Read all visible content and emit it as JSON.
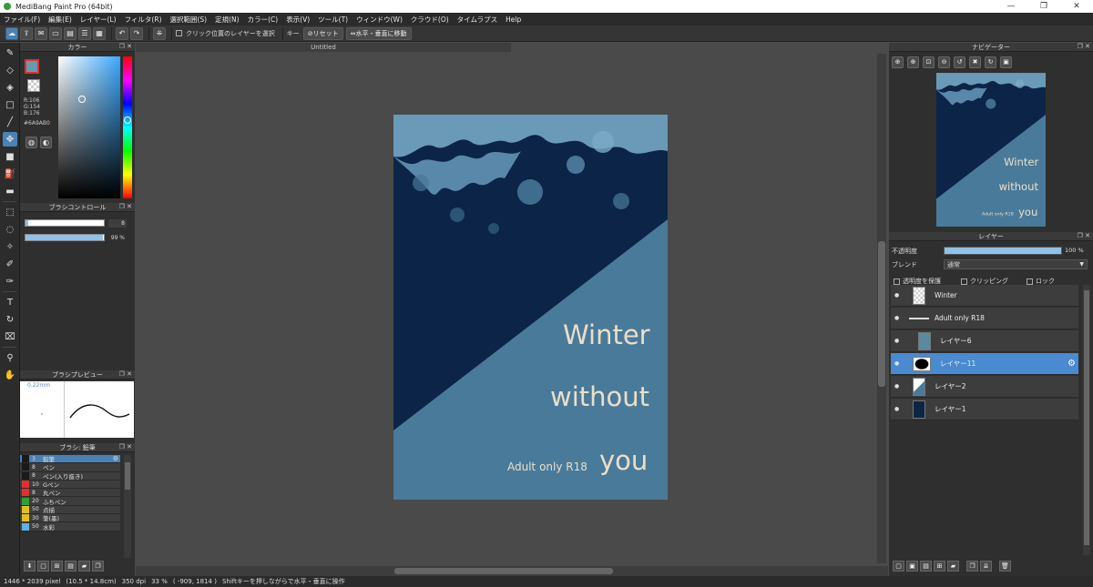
{
  "window": {
    "title": "MediBang Paint Pro (64bit)",
    "minimize": "—",
    "maximize": "❐",
    "close": "✕"
  },
  "menu": [
    "ファイル(F)",
    "編集(E)",
    "レイヤー(L)",
    "フィルタ(R)",
    "選択範囲(S)",
    "定規(N)",
    "カラー(C)",
    "表示(V)",
    "ツール(T)",
    "ウィンドウ(W)",
    "クラウド(O)",
    "タイムラプス",
    "Help"
  ],
  "toolbar": {
    "select_clicked_layer": "クリック位置のレイヤーを選択",
    "key_label": "キー",
    "reset_label": "リセット",
    "flip_label": "水平・垂直に移動"
  },
  "color_panel": {
    "title": "カラー",
    "r": "R:106",
    "g": "G:154",
    "b": "B:176",
    "hex": "#6A9AB0",
    "fg_color": "#6a9ab0"
  },
  "brush_control": {
    "title": "ブラシコントロール",
    "size_value": "8",
    "opacity_value": "99 %",
    "opacity_fraction": 0.99
  },
  "brush_preview": {
    "title": "ブラシプレビュー",
    "size": "0.22mm"
  },
  "brush_list": {
    "title": "ブラシ: 鉛筆",
    "items": [
      {
        "size": "3",
        "name": "鉛筆",
        "color": "#1a1a1a",
        "active": true
      },
      {
        "size": "8",
        "name": "ペン",
        "color": "#1a1a1a"
      },
      {
        "size": "8",
        "name": "ペン(入り抜き)",
        "color": "#1a1a1a"
      },
      {
        "size": "10",
        "name": "Gペン",
        "color": "#e03030"
      },
      {
        "size": "8",
        "name": "丸ペン",
        "color": "#e03030"
      },
      {
        "size": "20",
        "name": "ふちペン",
        "color": "#30a030"
      },
      {
        "size": "50",
        "name": "点描",
        "color": "#e0c020"
      },
      {
        "size": "30",
        "name": "筆(墨)",
        "color": "#e0c020"
      },
      {
        "size": "50",
        "name": "水彩",
        "color": "#60b0e0"
      }
    ]
  },
  "canvas": {
    "tab_title": "Untitled",
    "poster": {
      "line1": "Winter",
      "line2": "without",
      "line3": "you",
      "subtitle": "Adult only R18"
    }
  },
  "navigator": {
    "title": "ナビゲーター"
  },
  "layers": {
    "title": "レイヤー",
    "opacity_label": "不透明度",
    "opacity_value": "100 %",
    "blend_label": "ブレンド",
    "blend_value": "通常",
    "protect_alpha": "透明度を保護",
    "clipping": "クリッピング",
    "lock": "ロック",
    "items": [
      {
        "name": "Winter",
        "thumb": "checker"
      },
      {
        "name": "Adult only R18",
        "thumb": "line"
      },
      {
        "name": "レイヤー6",
        "thumb": "#5a8aa0",
        "indent": true
      },
      {
        "name": "レイヤー11",
        "thumb": "black",
        "active": true
      },
      {
        "name": "レイヤー2",
        "thumb": "diag"
      },
      {
        "name": "レイヤー1",
        "thumb": "#0d2545"
      }
    ]
  },
  "status": {
    "size": "1446 * 2039 pixel",
    "physical": "(10.5 * 14.8cm)",
    "dpi": "350 dpi",
    "zoom": "33 %",
    "coords": "( -909, 1814 )",
    "hint": "Shiftキーを押しながらで水平・垂直に操作"
  }
}
